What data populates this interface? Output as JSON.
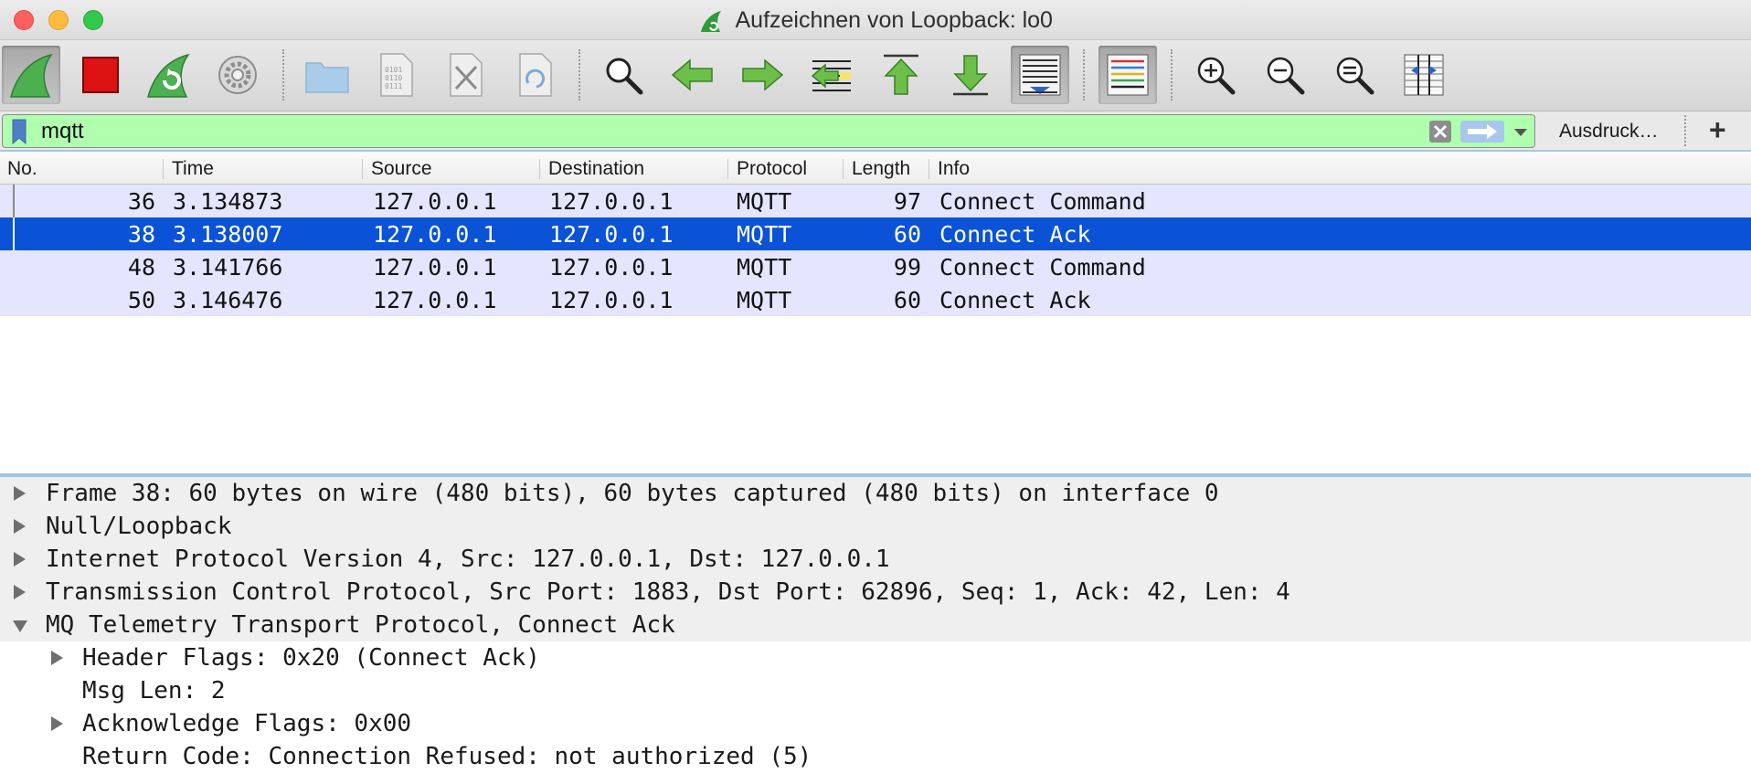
{
  "window": {
    "title": "Aufzeichnen von Loopback: lo0"
  },
  "toolbar": {
    "buttons": [
      {
        "name": "start-capture",
        "icon": "shark-fin-icon"
      },
      {
        "name": "stop-capture",
        "icon": "stop-square-icon"
      },
      {
        "name": "restart-capture",
        "icon": "restart-shark-icon"
      },
      {
        "name": "capture-options",
        "icon": "gear-icon"
      },
      {
        "name": "open-file",
        "icon": "folder-icon"
      },
      {
        "name": "save-file",
        "icon": "binary-file-icon"
      },
      {
        "name": "close-file",
        "icon": "close-file-icon"
      },
      {
        "name": "reload-file",
        "icon": "reload-file-icon"
      },
      {
        "name": "find-packet",
        "icon": "magnifier-icon"
      },
      {
        "name": "go-back",
        "icon": "arrow-left-icon"
      },
      {
        "name": "go-forward",
        "icon": "arrow-right-icon"
      },
      {
        "name": "go-to-packet",
        "icon": "go-to-packet-icon"
      },
      {
        "name": "go-first",
        "icon": "arrow-up-first-icon"
      },
      {
        "name": "go-last",
        "icon": "arrow-down-last-icon"
      },
      {
        "name": "autoscroll",
        "icon": "autoscroll-icon"
      },
      {
        "name": "colorize",
        "icon": "colorize-lines-icon"
      },
      {
        "name": "zoom-in",
        "icon": "zoom-in-icon"
      },
      {
        "name": "zoom-out",
        "icon": "zoom-out-icon"
      },
      {
        "name": "zoom-normal",
        "icon": "zoom-normal-icon"
      },
      {
        "name": "resize-columns",
        "icon": "resize-columns-icon"
      }
    ]
  },
  "filter": {
    "value": "mqtt",
    "expression_button": "Ausdruck…",
    "add_button": "+",
    "background": "#afffaf"
  },
  "packet_list": {
    "columns": [
      "No.",
      "Time",
      "Source",
      "Destination",
      "Protocol",
      "Length",
      "Info"
    ],
    "rows": [
      {
        "no": "36",
        "time": "3.134873",
        "source": "127.0.0.1",
        "destination": "127.0.0.1",
        "protocol": "MQTT",
        "length": "97",
        "info": "Connect Command"
      },
      {
        "no": "38",
        "time": "3.138007",
        "source": "127.0.0.1",
        "destination": "127.0.0.1",
        "protocol": "MQTT",
        "length": "60",
        "info": "Connect Ack"
      },
      {
        "no": "48",
        "time": "3.141766",
        "source": "127.0.0.1",
        "destination": "127.0.0.1",
        "protocol": "MQTT",
        "length": "99",
        "info": "Connect Command"
      },
      {
        "no": "50",
        "time": "3.146476",
        "source": "127.0.0.1",
        "destination": "127.0.0.1",
        "protocol": "MQTT",
        "length": "60",
        "info": "Connect Ack"
      }
    ],
    "selected_row": 1,
    "row_color": "#e5e5ff",
    "selected_color": "#0a53d6"
  },
  "details": {
    "items": [
      {
        "text": "Frame 38: 60 bytes on wire (480 bits), 60 bytes captured (480 bits) on interface 0",
        "state": "collapsed"
      },
      {
        "text": "Null/Loopback",
        "state": "collapsed"
      },
      {
        "text": "Internet Protocol Version 4, Src: 127.0.0.1, Dst: 127.0.0.1",
        "state": "collapsed"
      },
      {
        "text": "Transmission Control Protocol, Src Port: 1883, Dst Port: 62896, Seq: 1, Ack: 42, Len: 4",
        "state": "collapsed"
      },
      {
        "text": "MQ Telemetry Transport Protocol, Connect Ack",
        "state": "expanded"
      }
    ],
    "children": [
      {
        "text": "Header Flags: 0x20 (Connect Ack)",
        "state": "collapsed"
      },
      {
        "text": "Msg Len: 2",
        "state": "leaf"
      },
      {
        "text": "Acknowledge Flags: 0x00",
        "state": "collapsed"
      },
      {
        "text": "Return Code: Connection Refused: not authorized (5)",
        "state": "leaf"
      }
    ]
  }
}
